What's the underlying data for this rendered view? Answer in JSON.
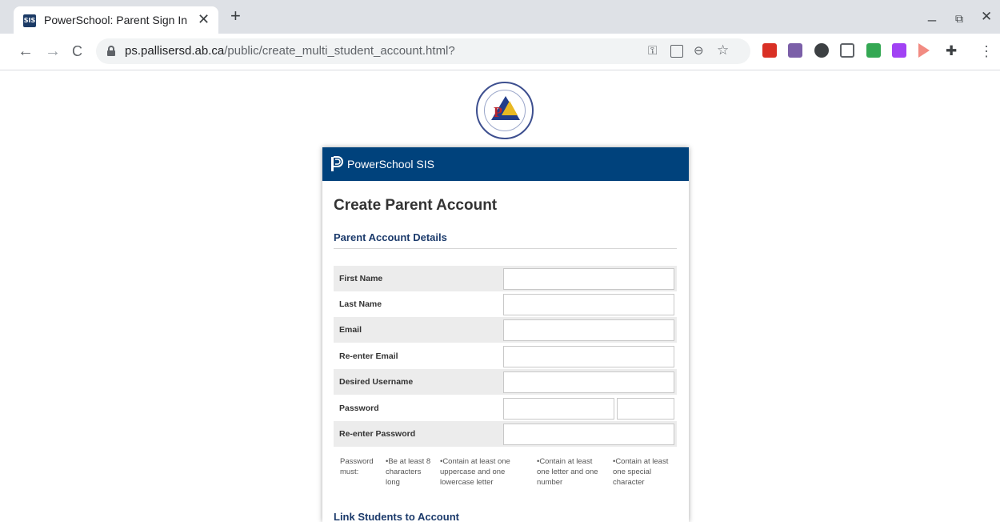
{
  "browser": {
    "tab_title": "PowerSchool: Parent Sign In",
    "tab_favicon": "SIS",
    "url_host": "ps.pallisersd.ab.ca",
    "url_path": "/public/create_multi_student_account.html?"
  },
  "icons": {
    "back": "←",
    "forward": "→",
    "reload": "C",
    "close": "✕",
    "new_tab": "+",
    "minimize": "_",
    "restore": "⧉",
    "window_close": "✕",
    "key": "⚿",
    "zoom": "⊖",
    "star": "☆",
    "menu": "⋮",
    "puzzle": "✚"
  },
  "logo": {
    "letter": "P"
  },
  "header": {
    "brand": "PowerSchool SIS"
  },
  "page": {
    "title": "Create Parent Account",
    "section_title": "Parent Account Details",
    "fields": [
      {
        "label": "First Name"
      },
      {
        "label": "Last Name"
      },
      {
        "label": "Email"
      },
      {
        "label": "Re-enter Email"
      },
      {
        "label": "Desired Username"
      },
      {
        "label": "Password"
      },
      {
        "label": "Re-enter Password"
      }
    ],
    "password_rules": {
      "intro": "Password must:",
      "rules": [
        "•Be at least 8 characters long",
        "•Contain at least one uppercase and one lowercase letter",
        "•Contain at least one letter and one number",
        "•Contain at least one special character"
      ]
    },
    "link_section_title": "Link Students to Account"
  },
  "colors": {
    "header_bg": "#00427c",
    "section_title": "#1b3a6b",
    "row_shade": "#ececec"
  }
}
